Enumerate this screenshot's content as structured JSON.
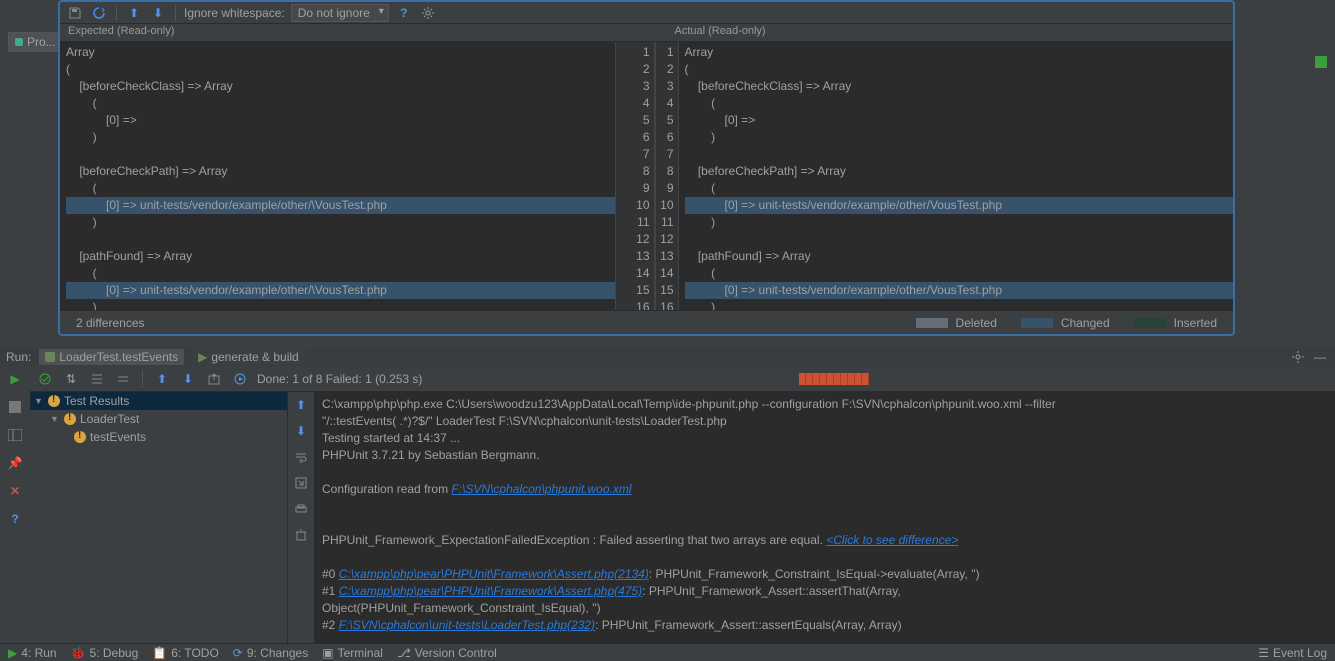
{
  "topToolbar": {
    "ignoreWhitespaceLabel": "Ignore whitespace:",
    "ignoreWhitespaceValue": "Do not ignore"
  },
  "projectTab": "Pro...",
  "diff": {
    "expectedHeader": "Expected (Read-only)",
    "actualHeader": "Actual (Read-only)",
    "differencesText": "2 differences",
    "legend": {
      "deleted": "Deleted",
      "changed": "Changed",
      "inserted": "Inserted"
    },
    "expectedLines": [
      {
        "n": "",
        "t": "Array"
      },
      {
        "n": "",
        "t": "("
      },
      {
        "n": "",
        "t": "    [beforeCheckClass] => Array"
      },
      {
        "n": "",
        "t": "        ("
      },
      {
        "n": "",
        "t": "            [0] =>"
      },
      {
        "n": "",
        "t": "        )"
      },
      {
        "n": "",
        "t": ""
      },
      {
        "n": "",
        "t": "    [beforeCheckPath] => Array"
      },
      {
        "n": "",
        "t": "        ("
      },
      {
        "n": "",
        "t": "            [0] => unit-tests/vendor/example/other/\\VousTest.php",
        "changed": true
      },
      {
        "n": "",
        "t": "        )"
      },
      {
        "n": "",
        "t": ""
      },
      {
        "n": "",
        "t": "    [pathFound] => Array"
      },
      {
        "n": "",
        "t": "        ("
      },
      {
        "n": "",
        "t": "            [0] => unit-tests/vendor/example/other/\\VousTest.php",
        "changed": true
      },
      {
        "n": "",
        "t": "        )"
      }
    ],
    "actualLines": [
      {
        "n": 1,
        "t": "Array"
      },
      {
        "n": 2,
        "t": "("
      },
      {
        "n": 3,
        "t": "    [beforeCheckClass] => Array"
      },
      {
        "n": 4,
        "t": "        ("
      },
      {
        "n": 5,
        "t": "            [0] =>"
      },
      {
        "n": 6,
        "t": "        )"
      },
      {
        "n": 7,
        "t": ""
      },
      {
        "n": 8,
        "t": "    [beforeCheckPath] => Array"
      },
      {
        "n": 9,
        "t": "        ("
      },
      {
        "n": 10,
        "t": "            [0] => unit-tests/vendor/example/other/VousTest.php",
        "changed": true
      },
      {
        "n": 11,
        "t": "        )"
      },
      {
        "n": 12,
        "t": ""
      },
      {
        "n": 13,
        "t": "    [pathFound] => Array"
      },
      {
        "n": 14,
        "t": "        ("
      },
      {
        "n": 15,
        "t": "            [0] => unit-tests/vendor/example/other/VousTest.php",
        "changed": true
      },
      {
        "n": 16,
        "t": "        )"
      }
    ]
  },
  "runRow": {
    "runLabel": "Run:",
    "tab1": "LoaderTest.testEvents",
    "tab2": "generate & build"
  },
  "testToolbar": {
    "doneText": "Done: 1 of 8  Failed: 1  (0.253 s)"
  },
  "tree": {
    "root": "Test Results",
    "node1": "LoaderTest",
    "node2": "testEvents"
  },
  "console": {
    "l1a": "C:\\xampp\\php\\php.exe C:\\Users\\woodzu123\\AppData\\Local\\Temp\\ide-phpunit.php --configuration F:\\SVN\\cphalcon\\phpunit.woo.xml --filter",
    "l1b": " \"/::testEvents( .*)?$/\" LoaderTest F:\\SVN\\cphalcon\\unit-tests\\LoaderTest.php",
    "l2": "Testing started at 14:37 ...",
    "l3": "PHPUnit 3.7.21 by Sebastian Bergmann.",
    "l4a": "Configuration read from ",
    "l4b": "F:\\SVN\\cphalcon\\phpunit.woo.xml",
    "l5a": "PHPUnit_Framework_ExpectationFailedException : Failed asserting that two arrays are equal. ",
    "l5b": "<Click to see difference>",
    "l6a": "#0 ",
    "l6b": "C:\\xampp\\php\\pear\\PHPUnit\\Framework\\Assert.php(2134)",
    "l6c": ": PHPUnit_Framework_Constraint_IsEqual->evaluate(Array, '')",
    "l7a": "#1 ",
    "l7b": "C:\\xampp\\php\\pear\\PHPUnit\\Framework\\Assert.php(475)",
    "l7c": ": PHPUnit_Framework_Assert::assertThat(Array,",
    "l8": "   Object(PHPUnit_Framework_Constraint_IsEqual), '')",
    "l9a": "#2 ",
    "l9b": "F:\\SVN\\cphalcon\\unit-tests\\LoaderTest.php(232)",
    "l9c": ": PHPUnit_Framework_Assert::assertEquals(Array, Array)"
  },
  "bottomBar": {
    "run": "4: Run",
    "debug": "5: Debug",
    "todo": "6: TODO",
    "changes": "9: Changes",
    "terminal": "Terminal",
    "vcs": "Version Control",
    "eventLog": "Event Log"
  }
}
